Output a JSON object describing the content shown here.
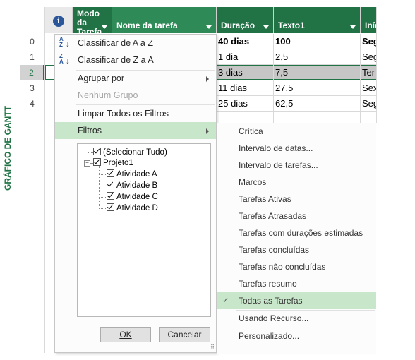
{
  "grid": {
    "headers": {
      "mode_line1": "Modo",
      "mode_line2": "da",
      "mode_line3": "Tarefa",
      "task_name": "Nome da tarefa",
      "duration": "Duração",
      "text1": "Texto1",
      "start": "Iníc"
    },
    "row_numbers": [
      "0",
      "1",
      "2",
      "3",
      "4"
    ],
    "rows": [
      {
        "duration": "40 dias",
        "text1": "100",
        "start": "Seg"
      },
      {
        "duration": "1 dia",
        "text1": "2,5",
        "start": "Seg"
      },
      {
        "duration": "3 dias",
        "text1": "7,5",
        "start": "Ter"
      },
      {
        "duration": "11 dias",
        "text1": "27,5",
        "start": "Sex"
      },
      {
        "duration": "25 dias",
        "text1": "62,5",
        "start": "Seg"
      }
    ]
  },
  "side_label": "GRÁFICO DE GANTT",
  "menu": {
    "sort_az": "Classificar de A a Z",
    "sort_za": "Classificar de Z a A",
    "group_by": "Agrupar por",
    "no_group": "Nenhum Grupo",
    "clear_filters": "Limpar Todos os Filtros",
    "filters": "Filtros",
    "tree": {
      "select_all": "(Selecionar Tudo)",
      "project": "Projeto1",
      "items": [
        "Atividade A",
        "Atividade B",
        "Atividade C",
        "Atividade D"
      ]
    },
    "ok": "OK",
    "cancel": "Cancelar"
  },
  "submenu": {
    "items": [
      "Crítica",
      "Intervalo de datas...",
      "Intervalo de tarefas...",
      "Marcos",
      "Tarefas Ativas",
      "Tarefas Atrasadas",
      "Tarefas com durações estimadas",
      "Tarefas concluídas",
      "Tarefas não concluídas",
      "Tarefas resumo",
      "Todas as Tarefas",
      "Usando Recurso...",
      "Personalizado..."
    ],
    "checked_index": 10
  },
  "colors": {
    "accent": "#217346",
    "highlight": "#c8e6c9",
    "selected_row": "#c6c6c6"
  }
}
